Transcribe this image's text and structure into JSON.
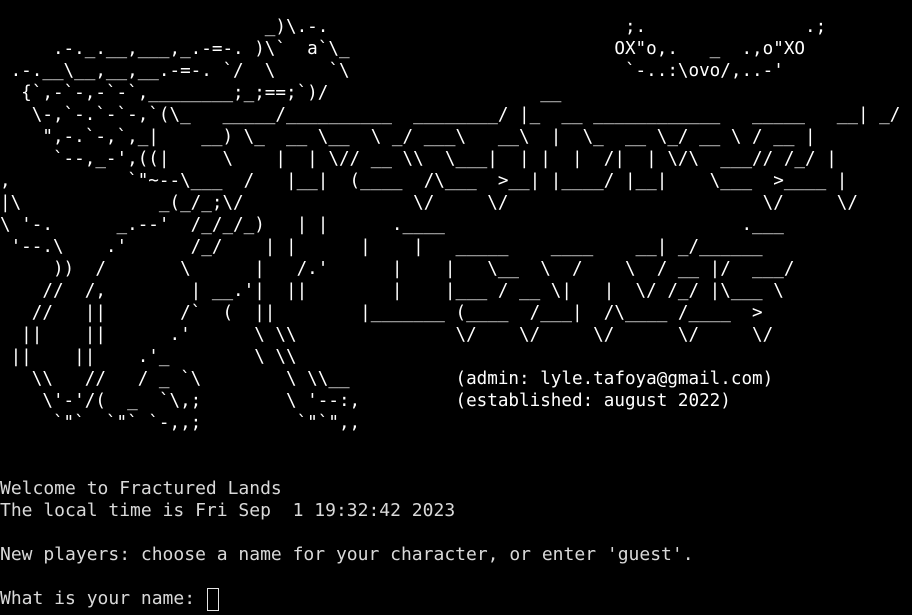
{
  "terminal": {
    "banner_lines": [
      "                         _)\\.-.                            ;.               .;",
      "     .-._.__,___,_.-=-. )\\`  a`\\_                         OX\"o,.   _  .,o\"XO",
      " .-.__\\__,__,__.-=-. `/  \\     `\\                          `-..:\\ovo/,..-'",
      "  {`,-`-,-`-`,________;_;==;`)/                    __                                 .___",
      "   \\-,`-.`-`-,`(\\_   _____/__________  ________/ |_  __ ____________   _____   __| _/",
      "    \",-.`-,`,_|    __) \\_  __ \\__  \\ _/ ___\\   __\\  |  \\_  __ \\_/ __ \\ / __ |",
      "     `--,_-',((|     \\    |  | \\// __ \\\\  \\___|  | |  |  /|  | \\/\\  ___// /_/ |",
      ",           `\"~--\\___  /   |__|  (____  /\\___  >__| |____/ |__|    \\___  >____ |",
      "|\\             _(_/_;\\/                \\/     \\/                        \\/     \\/",
      "\\ '-.      _.--'  /_/_/_)   | |      .____                            .___",
      " '--.\\    .'      /_/    | |      |    |   _____    ____    __| _/______",
      "     ))  /       \\      |   /.'      |    |   \\__  \\  /    \\  / __ |/  ___/",
      "    //  /,        | __.'|  ||        |    |___ / __ \\|   |  \\/ /_/ |\\___ \\",
      "   //   ||       /`  (  ||        |_______ (____  /___|  /\\____ /____  >",
      "  ||    ||      .'      \\ \\\\               \\/    \\/     \\/      \\/     \\/",
      " ||    ||    .'_        \\ \\\\",
      "   \\\\   //   / _ `\\        \\ \\\\__          (admin: lyle.tafoya@gmail.com)",
      "    \\'-'/(  _  `\\,;        \\ '--:,         (established: august 2022)",
      "     `\"`  `\"` `-,,;         `\"`\",,"
    ],
    "welcome_line": "Welcome to Fractured Lands",
    "time_line": "The local time is Fri Sep  1 19:32:42 2023",
    "new_players_line": "New players: choose a name for your character, or enter 'guest'.",
    "prompt_label": "What is your name: ",
    "input_value": ""
  }
}
